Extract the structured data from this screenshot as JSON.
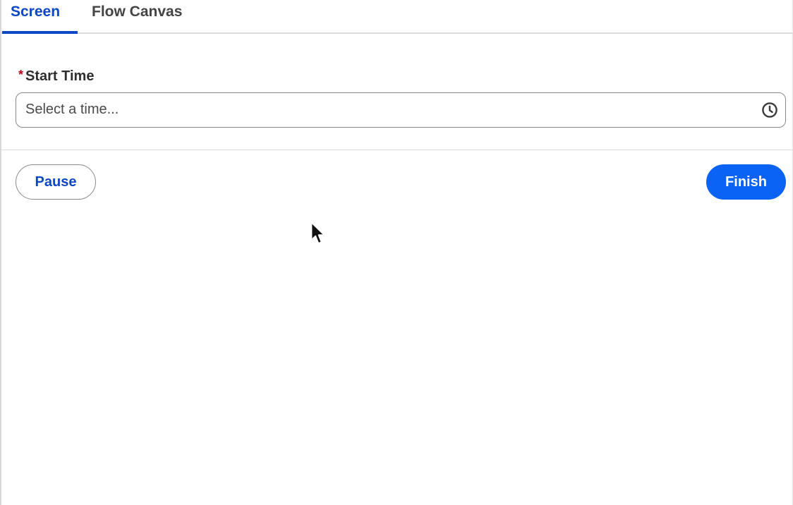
{
  "tabs": [
    {
      "label": "Screen",
      "active": true
    },
    {
      "label": "Flow Canvas",
      "active": false
    }
  ],
  "form": {
    "start_time": {
      "required_marker": "*",
      "label": "Start Time",
      "placeholder": "Select a time...",
      "value": "",
      "icon": "clock-icon"
    }
  },
  "footer": {
    "pause_label": "Pause",
    "finish_label": "Finish"
  },
  "colors": {
    "accent": "#0d47c4",
    "primary_button": "#0b63f6",
    "required": "#ba0517"
  }
}
